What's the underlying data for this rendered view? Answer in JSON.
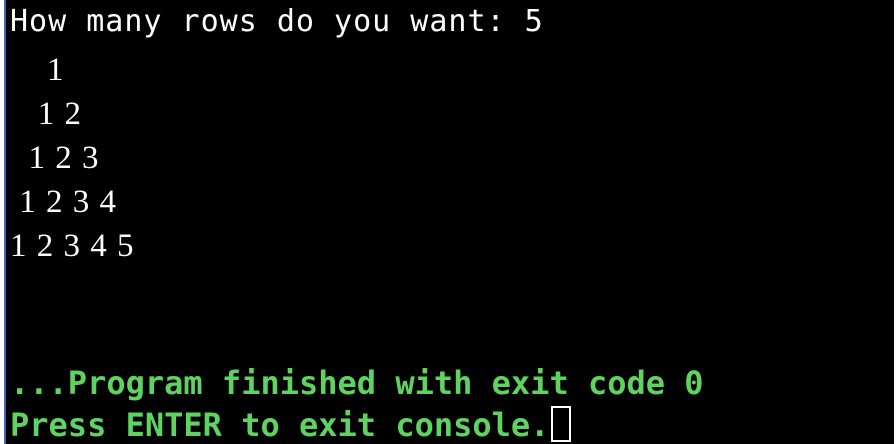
{
  "console": {
    "prompt_line": "How many rows do you want: 5",
    "output_rows": [
      "    1",
      "   1 2",
      "  1 2 3",
      " 1 2 3 4",
      "1 2 3 4 5"
    ],
    "exit_message": "...Program finished with exit code 0",
    "press_enter_message": "Press ENTER to exit console."
  },
  "colors": {
    "background": "#000000",
    "output_text": "#ffffff",
    "status_text": "#5fd35f",
    "left_border": "#2f6db5"
  }
}
